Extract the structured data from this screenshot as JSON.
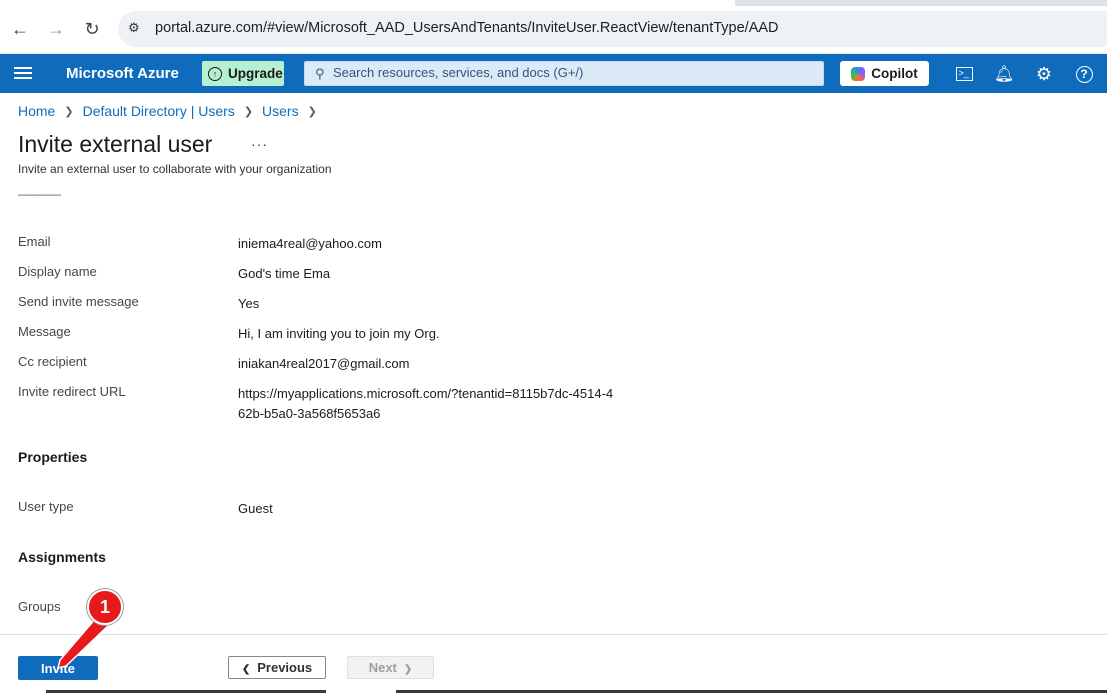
{
  "browser": {
    "url": "portal.azure.com/#view/Microsoft_AAD_UsersAndTenants/InviteUser.ReactView/tenantType/AAD",
    "icons": [
      "back-arrow-icon",
      "forward-arrow-icon",
      "reload-icon",
      "site-settings-icon"
    ]
  },
  "header": {
    "brand": "Microsoft Azure",
    "upgrade_label": "Upgrade",
    "search_placeholder": "Search resources, services, and docs (G+/)",
    "copilot_label": "Copilot",
    "accent_color": "#0f6cbd"
  },
  "breadcrumb": [
    "Home",
    "Default Directory | Users",
    "Users"
  ],
  "page": {
    "title": "Invite external user",
    "more": "···",
    "subtitle": "Invite an external user to collaborate with your organization"
  },
  "basics": [
    {
      "label": "Email",
      "value": "iniema4real@yahoo.com"
    },
    {
      "label": "Display name",
      "value": "God's time Ema"
    },
    {
      "label": "Send invite message",
      "value": "Yes"
    },
    {
      "label": "Message",
      "value": "Hi, I am inviting you to join my Org."
    },
    {
      "label": "Cc recipient",
      "value": "iniakan4real2017@gmail.com"
    },
    {
      "label": "Invite redirect URL",
      "value": "https://myapplications.microsoft.com/?tenantid=8115b7dc-4514-462b-b5a0-3a568f5653a6"
    }
  ],
  "properties": {
    "heading": "Properties",
    "rows": [
      {
        "label": "User type",
        "value": "Guest"
      }
    ]
  },
  "assignments": {
    "heading": "Assignments",
    "rows": [
      {
        "label": "Groups",
        "value": ""
      }
    ]
  },
  "footer": {
    "invite_label": "Invite",
    "previous_label": "Previous",
    "next_label": "Next"
  },
  "annotation": {
    "step": "1",
    "color": "#e8191b"
  }
}
